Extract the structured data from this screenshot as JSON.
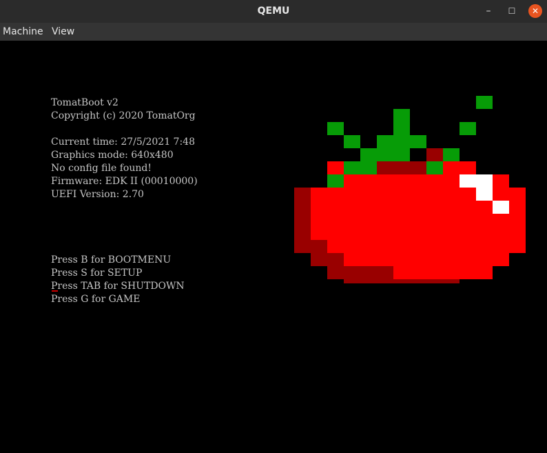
{
  "window": {
    "title": "QEMU",
    "minimize_glyph": "–",
    "maximize_glyph": "☐",
    "close_glyph": "✕"
  },
  "menu": {
    "items": [
      {
        "label": "Machine"
      },
      {
        "label": "View"
      }
    ]
  },
  "terminal": {
    "header": [
      "TomatBoot v2",
      "Copyright (c) 2020 TomatOrg"
    ],
    "info": [
      "Current time: 27/5/2021 7:48",
      "Graphics mode: 640x480",
      "No config file found!",
      "Firmware: EDK II (00010000)",
      "UEFI Version: 2.70"
    ],
    "keys": [
      "Press B for BOOTMENU",
      "Press S for SETUP",
      "Press TAB for SHUTDOWN",
      "Press G for GAME"
    ]
  },
  "logo": {
    "name": "tomato-pixel-art",
    "colors": {
      "G": "#079c07",
      "R": "#ff0000",
      "D": "#990000",
      "W": "#ffffff"
    },
    "pixels": [
      "...........G...",
      "......G........",
      "..G...G...G....",
      "...G.GGG.......",
      "....GGG.DG.....",
      "..RGGDDDGRR....",
      "..GRRRRRRRWWR..",
      "DRRRRRRRRRRWRR.",
      "DRRRRRRRRRRRWR.",
      "DRRRRRRRRRRRRR.",
      "DRRRRRRRRRRRRR.",
      "DDRRRRRRRRRRRR.",
      ".DDRRRRRRRRRR..",
      "..DDDDRRRRRR...",
      "...DDDDDDD....."
    ]
  }
}
